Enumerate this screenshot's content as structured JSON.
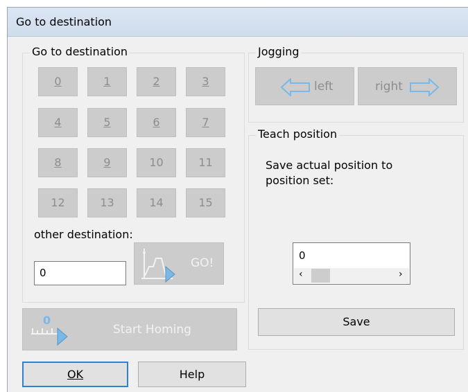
{
  "window": {
    "title": "Go to destination"
  },
  "destination_group": {
    "title": "Go to destination",
    "buttons": [
      "0",
      "1",
      "2",
      "3",
      "4",
      "5",
      "6",
      "7",
      "8",
      "9",
      "10",
      "11",
      "12",
      "13",
      "14",
      "15"
    ],
    "other_label": "other destination:",
    "other_value": "0",
    "go_label": "GO!"
  },
  "homing": {
    "label": "Start Homing",
    "icon_value": "0"
  },
  "jogging": {
    "title": "Jogging",
    "left_label": "left",
    "right_label": "right"
  },
  "teach": {
    "title": "Teach position",
    "text_line1": "Save actual position to",
    "text_line2": "position set:",
    "value": "0",
    "save_label": "Save"
  },
  "footer": {
    "ok_label": "OK",
    "help_label": "Help"
  },
  "colors": {
    "arrow": "#7ab8e8",
    "disabled_bg": "#cccccc",
    "title_bg": "#d6e2f0"
  }
}
